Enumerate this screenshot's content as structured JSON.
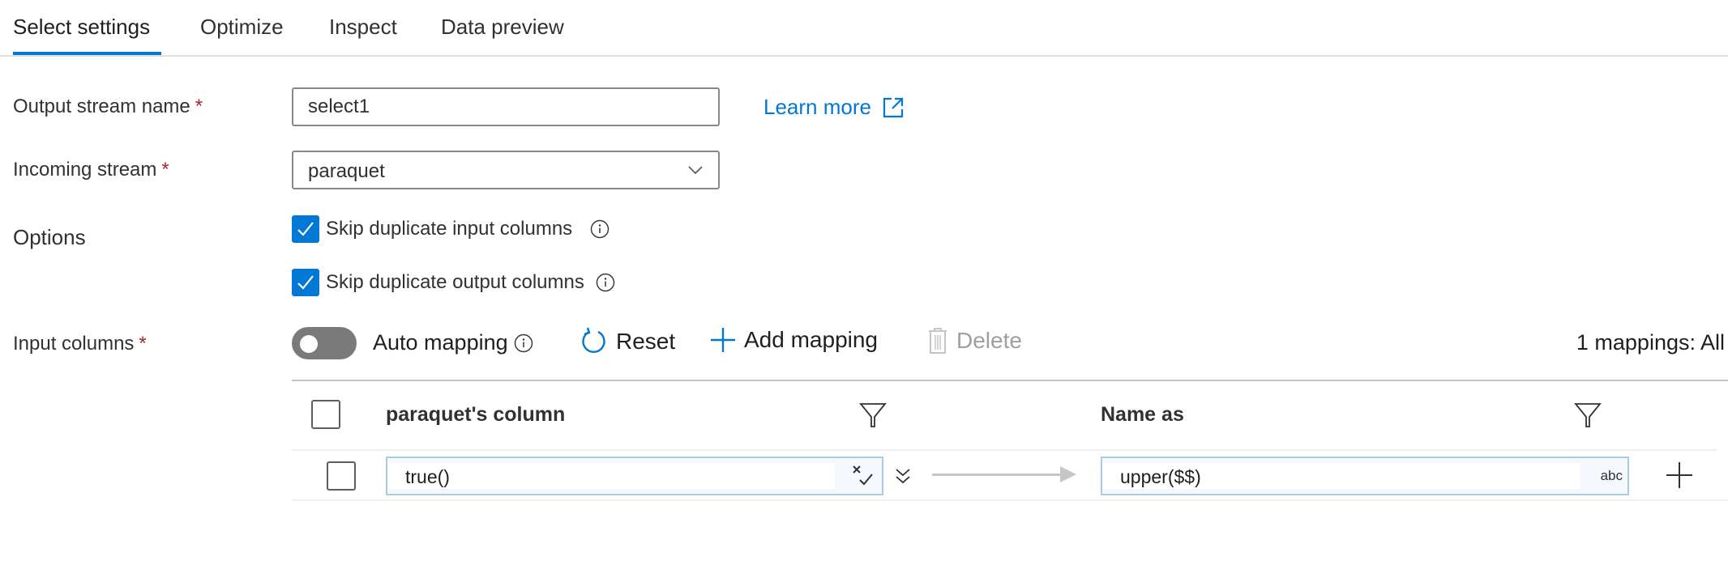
{
  "tabs": [
    {
      "label": "Select settings",
      "active": true
    },
    {
      "label": "Optimize",
      "active": false
    },
    {
      "label": "Inspect",
      "active": false
    },
    {
      "label": "Data preview",
      "active": false
    }
  ],
  "form": {
    "output_stream": {
      "label": "Output stream name",
      "required_mark": "*",
      "value": "select1"
    },
    "learn_more": {
      "label": "Learn more",
      "icon": "external-link-icon"
    },
    "incoming_stream": {
      "label": "Incoming stream",
      "required_mark": "*",
      "value": "paraquet"
    },
    "options": {
      "label": "Options",
      "items": [
        {
          "label": "Skip duplicate input columns",
          "checked": true
        },
        {
          "label": "Skip duplicate output columns",
          "checked": true
        }
      ]
    },
    "input_columns": {
      "label": "Input columns",
      "required_mark": "*"
    }
  },
  "toolbar": {
    "auto_mapping": {
      "label": "Auto mapping",
      "on": false
    },
    "reset_label": "Reset",
    "add_mapping_label": "Add mapping",
    "delete_label": "Delete",
    "mapping_count": "1 mappings: All"
  },
  "table": {
    "headers": {
      "source": "paraquet's column",
      "target": "Name as"
    },
    "rows": [
      {
        "source": "true()",
        "target": "upper($$)",
        "target_type": "abc",
        "selected": false
      }
    ]
  },
  "colors": {
    "accent": "#0078d4",
    "required": "#a4262c",
    "disabled": "#a19f9d"
  }
}
